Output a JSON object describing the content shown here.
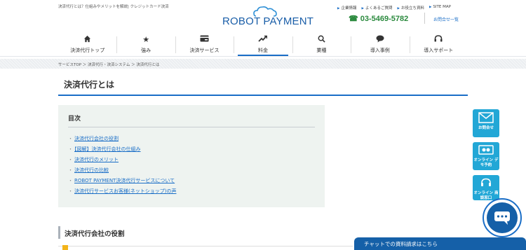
{
  "header": {
    "tagline": "決済代行とは？仕組みやメリットを解説| クレジットカード決済",
    "logo_text": "ROBOT PAYMENT",
    "top_links": [
      "企業情報",
      "よくあるご質問",
      "お役立ち資料",
      "SITE MAP"
    ],
    "phone": "03-5469-5782",
    "contact_list_label": "お問合せ一覧"
  },
  "nav": {
    "items": [
      {
        "label": "決済代行トップ",
        "icon": "home-icon"
      },
      {
        "label": "強み",
        "icon": "star-icon"
      },
      {
        "label": "決済サービス",
        "icon": "card-icon"
      },
      {
        "label": "料金",
        "icon": "chart-trend-icon"
      },
      {
        "label": "業種",
        "icon": "search-icon"
      },
      {
        "label": "導入事例",
        "icon": "comment-icon"
      },
      {
        "label": "導入サポート",
        "icon": "headset-icon"
      }
    ],
    "active_index": 3
  },
  "breadcrumb": "サービスTOP ＞ 決済代行・決済システム ＞ 決済代行とは",
  "page_title": "決済代行とは",
  "toc": {
    "heading": "目次",
    "items": [
      "決済代行会社の役割",
      "【図解】決済代行会社の仕組み",
      "決済代行のメリット",
      "決済代行の比較",
      "ROBOT PAYMENT決済代行サービスについて",
      "決済代行サービスお客様(ネットショップ)の声"
    ]
  },
  "side_buttons": [
    {
      "label": "お問合せ",
      "icon": "mail-icon"
    },
    {
      "label": "オンライン デモ予約",
      "icon": "video-icon"
    },
    {
      "label": "オンライン 商談窓口",
      "icon": "headset-icon"
    }
  ],
  "section_title": "決済代行会社の役割",
  "chat": {
    "label": "チャットでの資料請求はこちら"
  },
  "colors": {
    "brand": "#1a5ea8",
    "accent": "#1a6ec7",
    "phone": "#2b8a3e",
    "side": "#22a7d6",
    "chat": "#1560a8"
  }
}
